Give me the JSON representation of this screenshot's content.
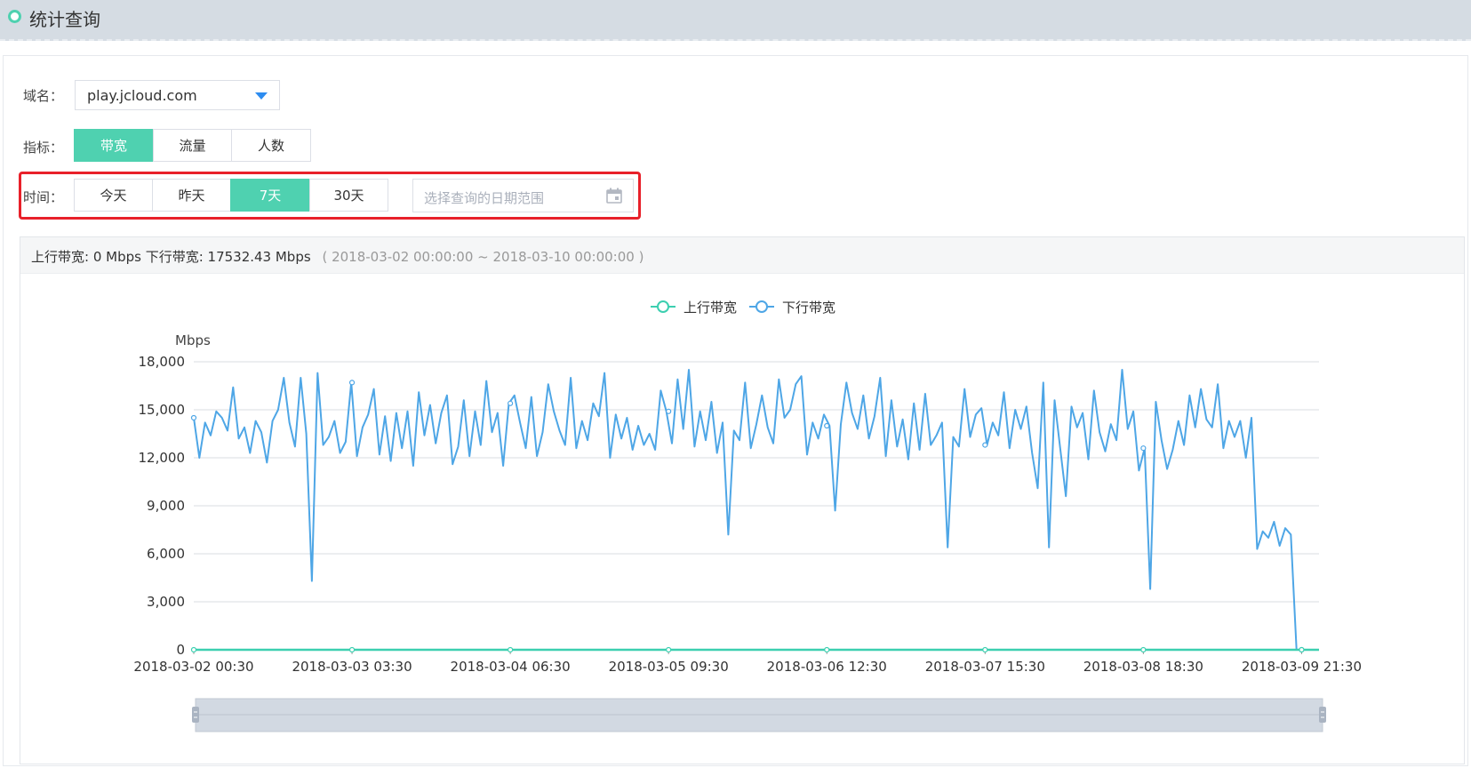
{
  "header": {
    "title": "统计查询"
  },
  "filters": {
    "domain_label": "域名：",
    "domain_value": "play.jcloud.com",
    "metric_label": "指标：",
    "metric_options": [
      "带宽",
      "流量",
      "人数"
    ],
    "metric_selected": "带宽",
    "time_label": "时间：",
    "time_options": [
      "今天",
      "昨天",
      "7天",
      "30天"
    ],
    "time_selected": "7天",
    "date_placeholder": "选择查询的日期范围"
  },
  "summary": {
    "text": "上行带宽: 0 Mbps 下行带宽: 17532.43 Mbps",
    "range": "( 2018-03-02 00:00:00 ~ 2018-03-10 00:00:00 )"
  },
  "colors": {
    "accent": "#4fd1b0",
    "series_down": "#4ea6e6",
    "series_up": "#3ccfb0",
    "highlight": "#e8202a"
  },
  "chart_data": {
    "type": "line",
    "ylabel": "Mbps",
    "ylim": [
      0,
      18000
    ],
    "yticks": [
      "18,000",
      "15,000",
      "12,000",
      "9,000",
      "6,000",
      "3,000",
      "0"
    ],
    "xticks": [
      "2018-03-02 00:30",
      "2018-03-03 03:30",
      "2018-03-04 06:30",
      "2018-03-05 09:30",
      "2018-03-06 12:30",
      "2018-03-07 15:30",
      "2018-03-08 18:30",
      "2018-03-09 21:30"
    ],
    "legend": [
      "上行带宽",
      "下行带宽"
    ],
    "legend_position": "top-center",
    "grid": true,
    "series": [
      {
        "name": "上行带宽",
        "values": [
          0,
          0,
          0,
          0,
          0,
          0,
          0,
          0
        ]
      },
      {
        "name": "下行带宽",
        "values": [
          14500,
          12000,
          14200,
          13400,
          14900,
          14500,
          13700,
          16400,
          13200,
          13900,
          12300,
          14300,
          13600,
          11700,
          14300,
          15000,
          17000,
          14200,
          12700,
          17000,
          13500,
          4300,
          17300,
          12800,
          13300,
          14300,
          12300,
          13000,
          16700,
          12100,
          13900,
          14700,
          16300,
          12200,
          14600,
          11800,
          14800,
          12600,
          14900,
          11500,
          16100,
          13400,
          15300,
          12900,
          14800,
          15900,
          11600,
          12700,
          15600,
          12100,
          14900,
          12800,
          16800,
          13600,
          14800,
          11500,
          15400,
          15900,
          14200,
          12600,
          15800,
          12100,
          13600,
          16600,
          14900,
          13700,
          12800,
          17000,
          12600,
          14300,
          13100,
          15400,
          14600,
          17300,
          12000,
          14700,
          13200,
          14500,
          12500,
          14000,
          12800,
          13500,
          12500,
          16200,
          14900,
          12900,
          16900,
          13800,
          17500,
          12700,
          14900,
          13100,
          15500,
          12300,
          14200,
          7200,
          13700,
          13100,
          16700,
          12600,
          14100,
          15900,
          13900,
          12900,
          16900,
          14500,
          15000,
          16600,
          17100,
          12200,
          14200,
          13200,
          14700,
          14000,
          8700,
          14100,
          16700,
          14800,
          13800,
          15900,
          13200,
          14600,
          17000,
          12100,
          15600,
          12700,
          14400,
          11900,
          15400,
          12500,
          16000,
          12800,
          13400,
          14200,
          6400,
          13300,
          12700,
          16300,
          13300,
          14700,
          15100,
          12800,
          14200,
          13400,
          16100,
          12600,
          15000,
          13800,
          15200,
          12300,
          10100,
          16700,
          6400,
          15600,
          12600,
          9600,
          15200,
          13900,
          14800,
          11900,
          16200,
          13600,
          12400,
          14100,
          13100,
          17500,
          13800,
          14900,
          11200,
          12600,
          3800,
          15500,
          13100,
          11300,
          12500,
          14300,
          12800,
          15900,
          13900,
          16300,
          14400,
          13900,
          16600,
          12600,
          14300,
          13300,
          14300,
          12000,
          14500,
          6300,
          7400,
          7000,
          8000,
          6500,
          7600,
          7200,
          0,
          0,
          0,
          0,
          0
        ]
      }
    ]
  }
}
